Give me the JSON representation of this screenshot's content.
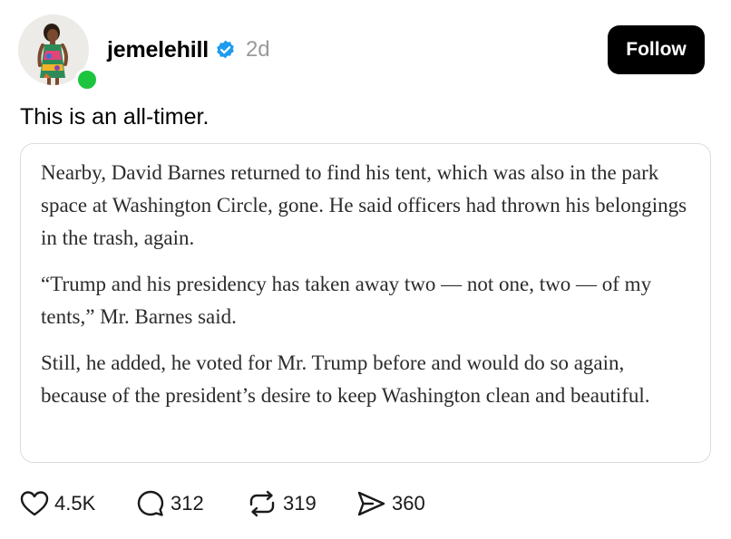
{
  "post": {
    "author": {
      "username": "jemelehill",
      "verified": true,
      "online": true,
      "avatar_icon": "profile-photo"
    },
    "time_ago": "2d",
    "follow_label": "Follow",
    "caption": "This is an all-timer.",
    "quote": {
      "paragraphs": [
        "Nearby, David Barnes returned to find his tent, which was also in the park space at Washington Circle, gone. He said officers had thrown his belongings in the trash, again.",
        "“Trump and his presidency has taken away two — not one, two — of my tents,” Mr. Barnes said.",
        "Still, he added, he voted for Mr. Trump before and would do so again, because of the president’s desire to keep Washington clean and beautiful."
      ]
    },
    "actions": {
      "likes": "4.5K",
      "comments": "312",
      "reposts": "319",
      "shares": "360"
    }
  },
  "colors": {
    "verified_badge": "#1d9bf0",
    "online_dot": "#1dc53f",
    "follow_button_bg": "#000000",
    "timestamp": "#9a9a9a",
    "card_border": "#dcdcdc",
    "quote_text": "#2b2b2b"
  }
}
